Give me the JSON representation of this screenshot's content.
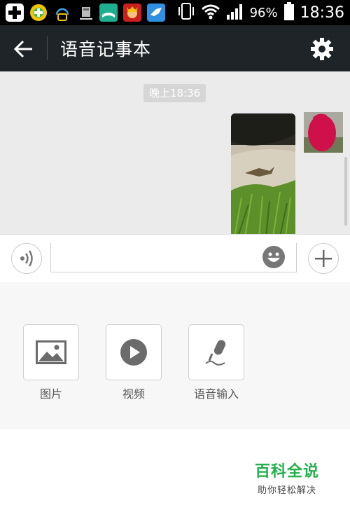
{
  "status_bar": {
    "battery": "96%",
    "time": "18:36",
    "icons": [
      "add-app-icon",
      "green-shield-icon",
      "chat-bubble-icon",
      "sd-card-icon",
      "book-app-icon",
      "game-app-icon",
      "bird-app-icon",
      "vibrate-icon",
      "wifi-icon",
      "signal-icon",
      "battery-icon"
    ]
  },
  "app_bar": {
    "title": "语音记事本",
    "icons": [
      "back-arrow-icon",
      "settings-gear-icon"
    ]
  },
  "chat": {
    "timestamp": "晚上18:36",
    "message": {
      "type": "image",
      "content": "photo of lizard on grass"
    }
  },
  "input_bar": {
    "text_value": "",
    "icons": [
      "voice-input-icon",
      "emoji-icon",
      "plus-icon"
    ]
  },
  "attach_panel": {
    "items": [
      {
        "label": "图片",
        "icon": "image-icon"
      },
      {
        "label": "视频",
        "icon": "video-play-icon"
      },
      {
        "label": "语音输入",
        "icon": "microphone-icon"
      }
    ]
  },
  "watermark": {
    "main": "百科全说",
    "sub": "助你轻松解决"
  },
  "colors": {
    "appbar_bg": "#1f2428",
    "chat_bg": "#ebebeb",
    "watermark_green": "#22b14c"
  }
}
